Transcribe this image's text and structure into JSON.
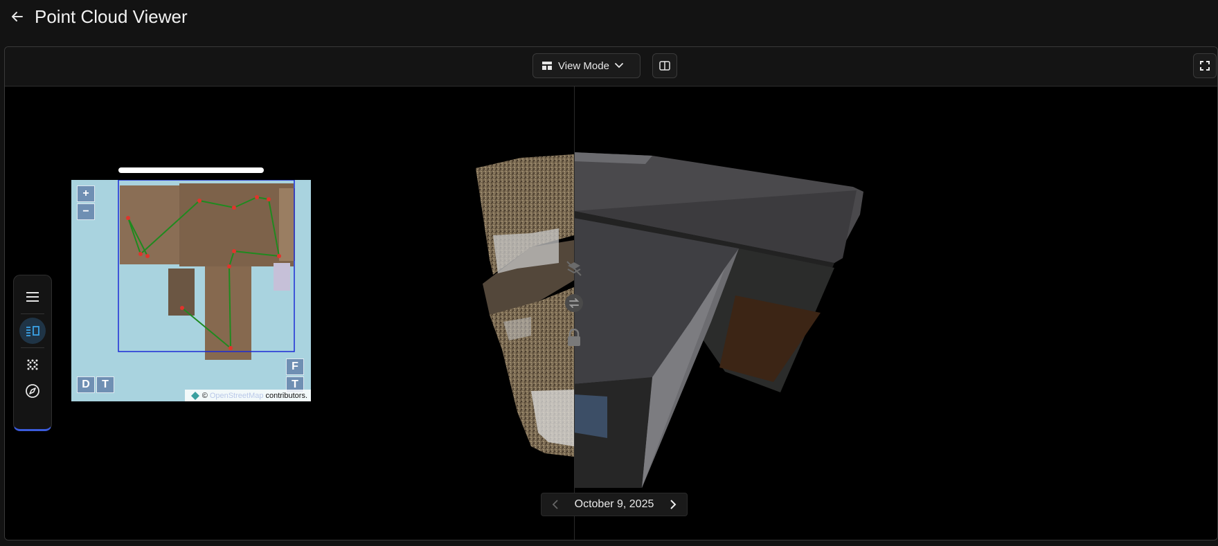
{
  "header": {
    "title": "Point Cloud Viewer",
    "back_icon": "arrow-left-icon"
  },
  "toolbar": {
    "view_mode_label": "View Mode",
    "view_mode_icon": "layout-icon",
    "split_icon": "split-view-icon",
    "fullscreen_icon": "fullscreen-icon"
  },
  "sidebar": {
    "items": [
      {
        "icon": "menu-icon",
        "active": false
      },
      {
        "icon": "split-layout-icon",
        "active": true
      },
      {
        "icon": "point-cloud-icon",
        "active": false
      },
      {
        "icon": "compass-icon",
        "active": false
      }
    ],
    "accent": "#3b5bdb"
  },
  "minimap": {
    "zoom_in": "+",
    "zoom_out": "−",
    "left_buttons": [
      "D",
      "T"
    ],
    "right_buttons": [
      "F",
      "T"
    ],
    "attribution": {
      "prefix": "©",
      "link": "OpenStreetMap",
      "suffix": "contributors."
    }
  },
  "viewer_controls": [
    "layers-off-icon",
    "swap-icon",
    "lock-icon"
  ],
  "date_nav": {
    "date": "October 9, 2025",
    "prev_icon": "chevron-left-icon",
    "next_icon": "chevron-right-icon"
  },
  "colors": {
    "background": "#131313",
    "viewport": "#000000",
    "map_water": "#a9d3df",
    "route": "#1f8a1f",
    "waypoint": "#e0342c",
    "map_border": "#1a2bd6"
  }
}
